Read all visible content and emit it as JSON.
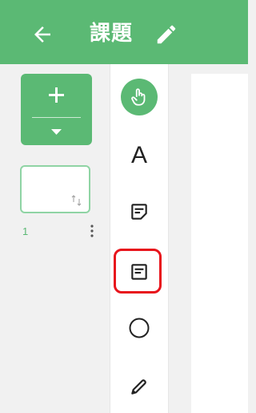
{
  "header": {
    "title": "課題",
    "back_icon": "arrow-left-icon",
    "edit_icon": "pencil-icon",
    "color": "#5bb974"
  },
  "pages": {
    "add_button": {
      "icon": "plus-icon",
      "dropdown_icon": "caret-down-icon"
    },
    "items": [
      {
        "number": "1",
        "sort_icon": "sort-arrows-icon",
        "menu_icon": "more-vertical-icon"
      }
    ]
  },
  "toolbar": {
    "tools": [
      {
        "id": "select",
        "icon": "hand-pointer-icon",
        "active": true
      },
      {
        "id": "text",
        "label": "A",
        "icon": "text-icon"
      },
      {
        "id": "sticky-note",
        "icon": "sticky-note-icon"
      },
      {
        "id": "card",
        "icon": "card-icon",
        "highlighted": true
      },
      {
        "id": "shape",
        "icon": "circle-icon"
      },
      {
        "id": "pen",
        "icon": "pencil-icon"
      }
    ],
    "highlight_color": "#e8141c"
  }
}
